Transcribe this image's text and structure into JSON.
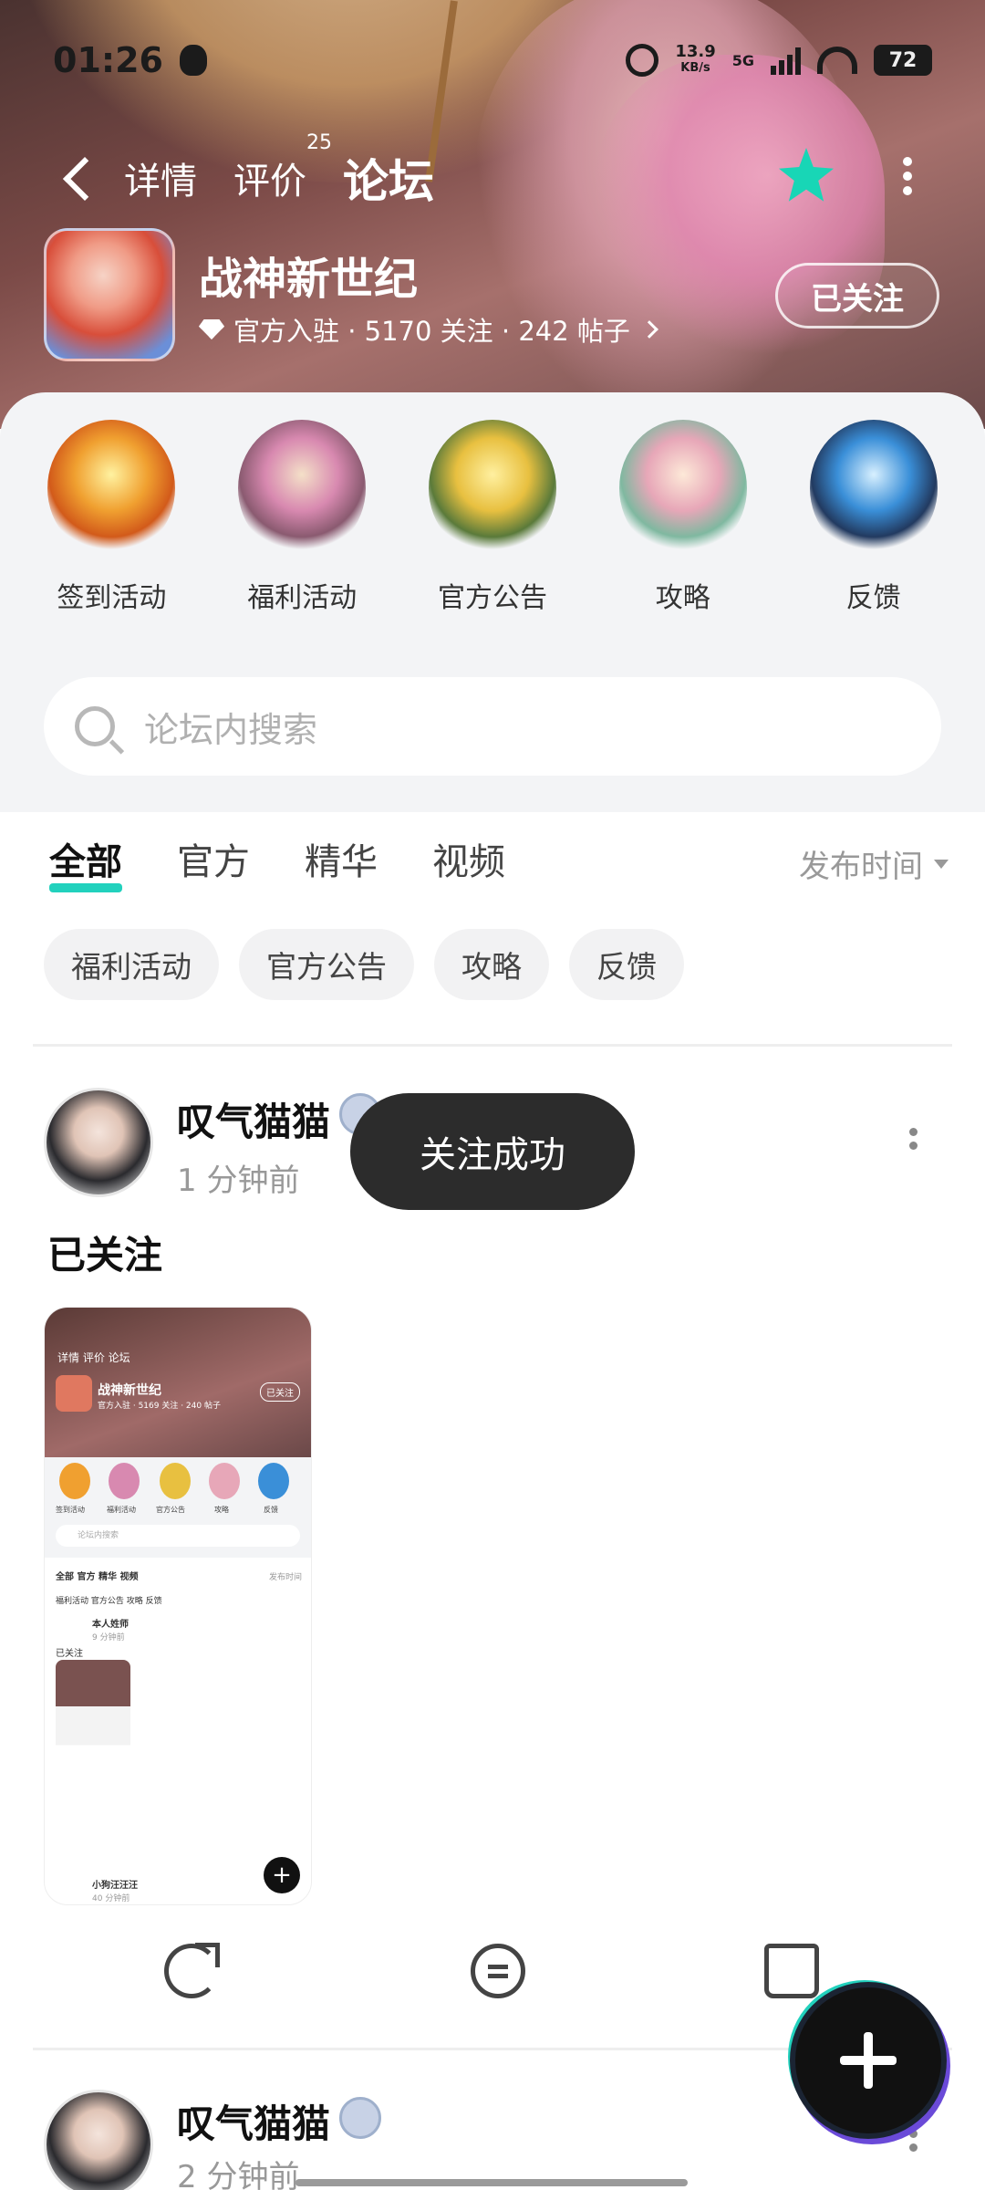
{
  "status_bar": {
    "time": "01:26",
    "net_speed": "13.9",
    "net_unit": "KB/s",
    "network": "5G",
    "battery": "72"
  },
  "nav": {
    "tabs": [
      {
        "label": "详情"
      },
      {
        "label": "评价",
        "count": "25"
      },
      {
        "label": "论坛"
      }
    ]
  },
  "game": {
    "name": "战神新世纪",
    "meta": "官方入驻 · 5170 关注 · 242 帖子",
    "follow_label": "已关注"
  },
  "categories": [
    {
      "label": "签到活动",
      "color": "#f0a030"
    },
    {
      "label": "福利活动",
      "color": "#d889b0"
    },
    {
      "label": "官方公告",
      "color": "#e8c040"
    },
    {
      "label": "攻略",
      "color": "#e7a7b8"
    },
    {
      "label": "反馈",
      "color": "#3a8fd8"
    }
  ],
  "search": {
    "placeholder": "论坛内搜索"
  },
  "filter_tabs": [
    "全部",
    "官方",
    "精华",
    "视频"
  ],
  "sort_label": "发布时间",
  "chips": [
    "福利活动",
    "官方公告",
    "攻略",
    "反馈"
  ],
  "posts": [
    {
      "author": "叹气猫猫",
      "time": "1 分钟前",
      "content": "已关注",
      "screenshot": {
        "tabs": "详情  评价  论坛",
        "game_name": "战神新世纪",
        "game_meta": "官方入驻 · 5169 关注 · 240 帖子",
        "follow": "已关注",
        "cats": [
          "签到活动",
          "福利活动",
          "官方公告",
          "攻略",
          "反馈"
        ],
        "search": "论坛内搜索",
        "ftabs": "全部   官方   精华   视频",
        "sort": "发布时间",
        "chips": "福利活动   官方公告   攻略   反馈",
        "author": "本人姓师",
        "time": "9 分钟前",
        "content": "已关注",
        "next_author": "小狗汪汪汪",
        "next_time": "40 分钟前"
      }
    },
    {
      "author": "叹气猫猫",
      "time": "2 分钟前"
    }
  ],
  "toast": "关注成功"
}
